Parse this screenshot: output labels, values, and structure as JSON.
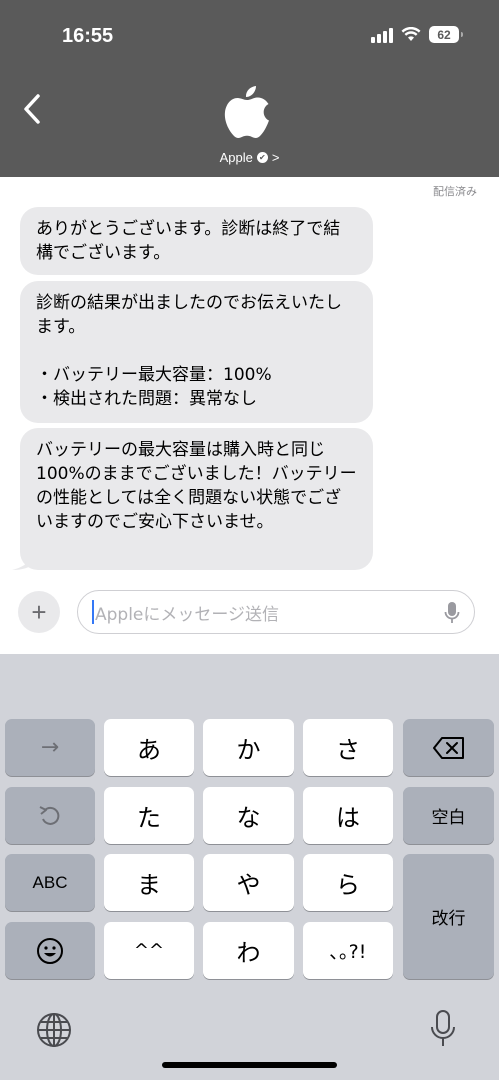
{
  "status_bar": {
    "time": "16:55",
    "battery": "62"
  },
  "header": {
    "contact_name": "Apple",
    "chevron": ">"
  },
  "thread": {
    "delivered_label": "配信済み",
    "messages": [
      "ありがとうございます。診断は終了で結構でございます。",
      "診断の結果が出ましたのでお伝えいたします。\n\n・バッテリー最大容量：100%\n・検出された問題：異常なし",
      "バッテリーの最大容量は購入時と同じ100%のままでございました！バッテリーの性能としては全く問題ない状態でございますのでご安心下さいませ。"
    ]
  },
  "composer": {
    "plus_label": "+",
    "placeholder": "Appleにメッセージ送信"
  },
  "keyboard": {
    "arrow": "→",
    "row1": [
      "あ",
      "か",
      "さ"
    ],
    "row2": [
      "た",
      "な",
      "は"
    ],
    "row3": [
      "ま",
      "や",
      "ら"
    ],
    "row4": [
      "^^",
      "わ",
      "､｡?!"
    ],
    "abc": "ABC",
    "space": "空白",
    "return": "改行"
  },
  "colors": {
    "header_bg": "#5a5a5a",
    "bubble_bg": "#e9e9eb",
    "keyboard_bg": "#d1d3d9",
    "cursor": "#3478f6"
  }
}
